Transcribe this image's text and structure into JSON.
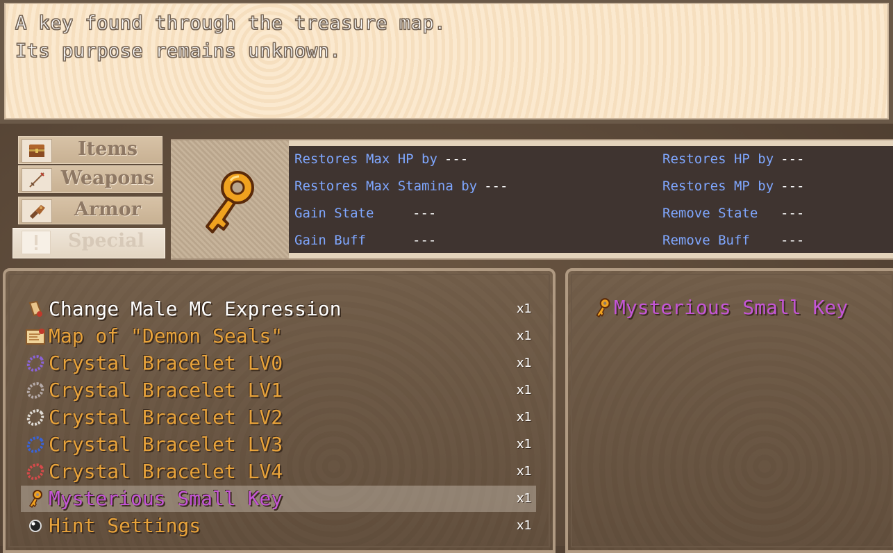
{
  "help": {
    "line1": "A key found through the treasure map.",
    "line2": "Its purpose remains unknown."
  },
  "categories": [
    {
      "label": "Items",
      "icon": "chest-icon"
    },
    {
      "label": "Weapons",
      "icon": "sword-icon"
    },
    {
      "label": "Armor",
      "icon": "gauntlet-icon"
    },
    {
      "label": "Special",
      "icon": "exclamation-icon",
      "selected": true
    }
  ],
  "status": {
    "icon": "golden-key-icon",
    "left": [
      {
        "label": "Restores Max HP by",
        "value": "---"
      },
      {
        "label": "Restores Max Stamina by",
        "value": "---"
      },
      {
        "label": "Gain State",
        "value": "---"
      },
      {
        "label": "Gain Buff",
        "value": "---"
      }
    ],
    "right": [
      {
        "label": "Restores HP by",
        "value": "---"
      },
      {
        "label": "Restores MP by",
        "value": "---"
      },
      {
        "label": "Remove State",
        "value": "---"
      },
      {
        "label": "Remove Buff",
        "value": "---"
      }
    ]
  },
  "items": [
    {
      "name": "Change Male MC Expression",
      "qty": "x1",
      "icon": "scroll-icon",
      "color": "white"
    },
    {
      "name": "Map of \"Demon Seals\"",
      "qty": "x1",
      "icon": "map-icon",
      "color": "orange"
    },
    {
      "name": "Crystal Bracelet LV0",
      "qty": "x1",
      "icon": "bracelet-purple-icon",
      "color": "orange"
    },
    {
      "name": "Crystal Bracelet LV1",
      "qty": "x1",
      "icon": "bracelet-gray-icon",
      "color": "orange"
    },
    {
      "name": "Crystal Bracelet LV2",
      "qty": "x1",
      "icon": "bracelet-white-icon",
      "color": "orange"
    },
    {
      "name": "Crystal Bracelet LV3",
      "qty": "x1",
      "icon": "bracelet-blue-icon",
      "color": "orange"
    },
    {
      "name": "Crystal Bracelet LV4",
      "qty": "x1",
      "icon": "bracelet-red-icon",
      "color": "orange"
    },
    {
      "name": "Mysterious Small Key",
      "qty": "x1",
      "icon": "key-icon",
      "color": "purple",
      "selected": true
    },
    {
      "name": "Hint Settings",
      "qty": "x1",
      "icon": "orb-icon",
      "color": "orange"
    }
  ],
  "detail": {
    "name": "Mysterious Small Key",
    "icon": "key-icon"
  },
  "colors": {
    "item_orange": "#e8a33b",
    "item_purple": "#c455d7",
    "stat_label_blue": "#7fa7ff"
  }
}
